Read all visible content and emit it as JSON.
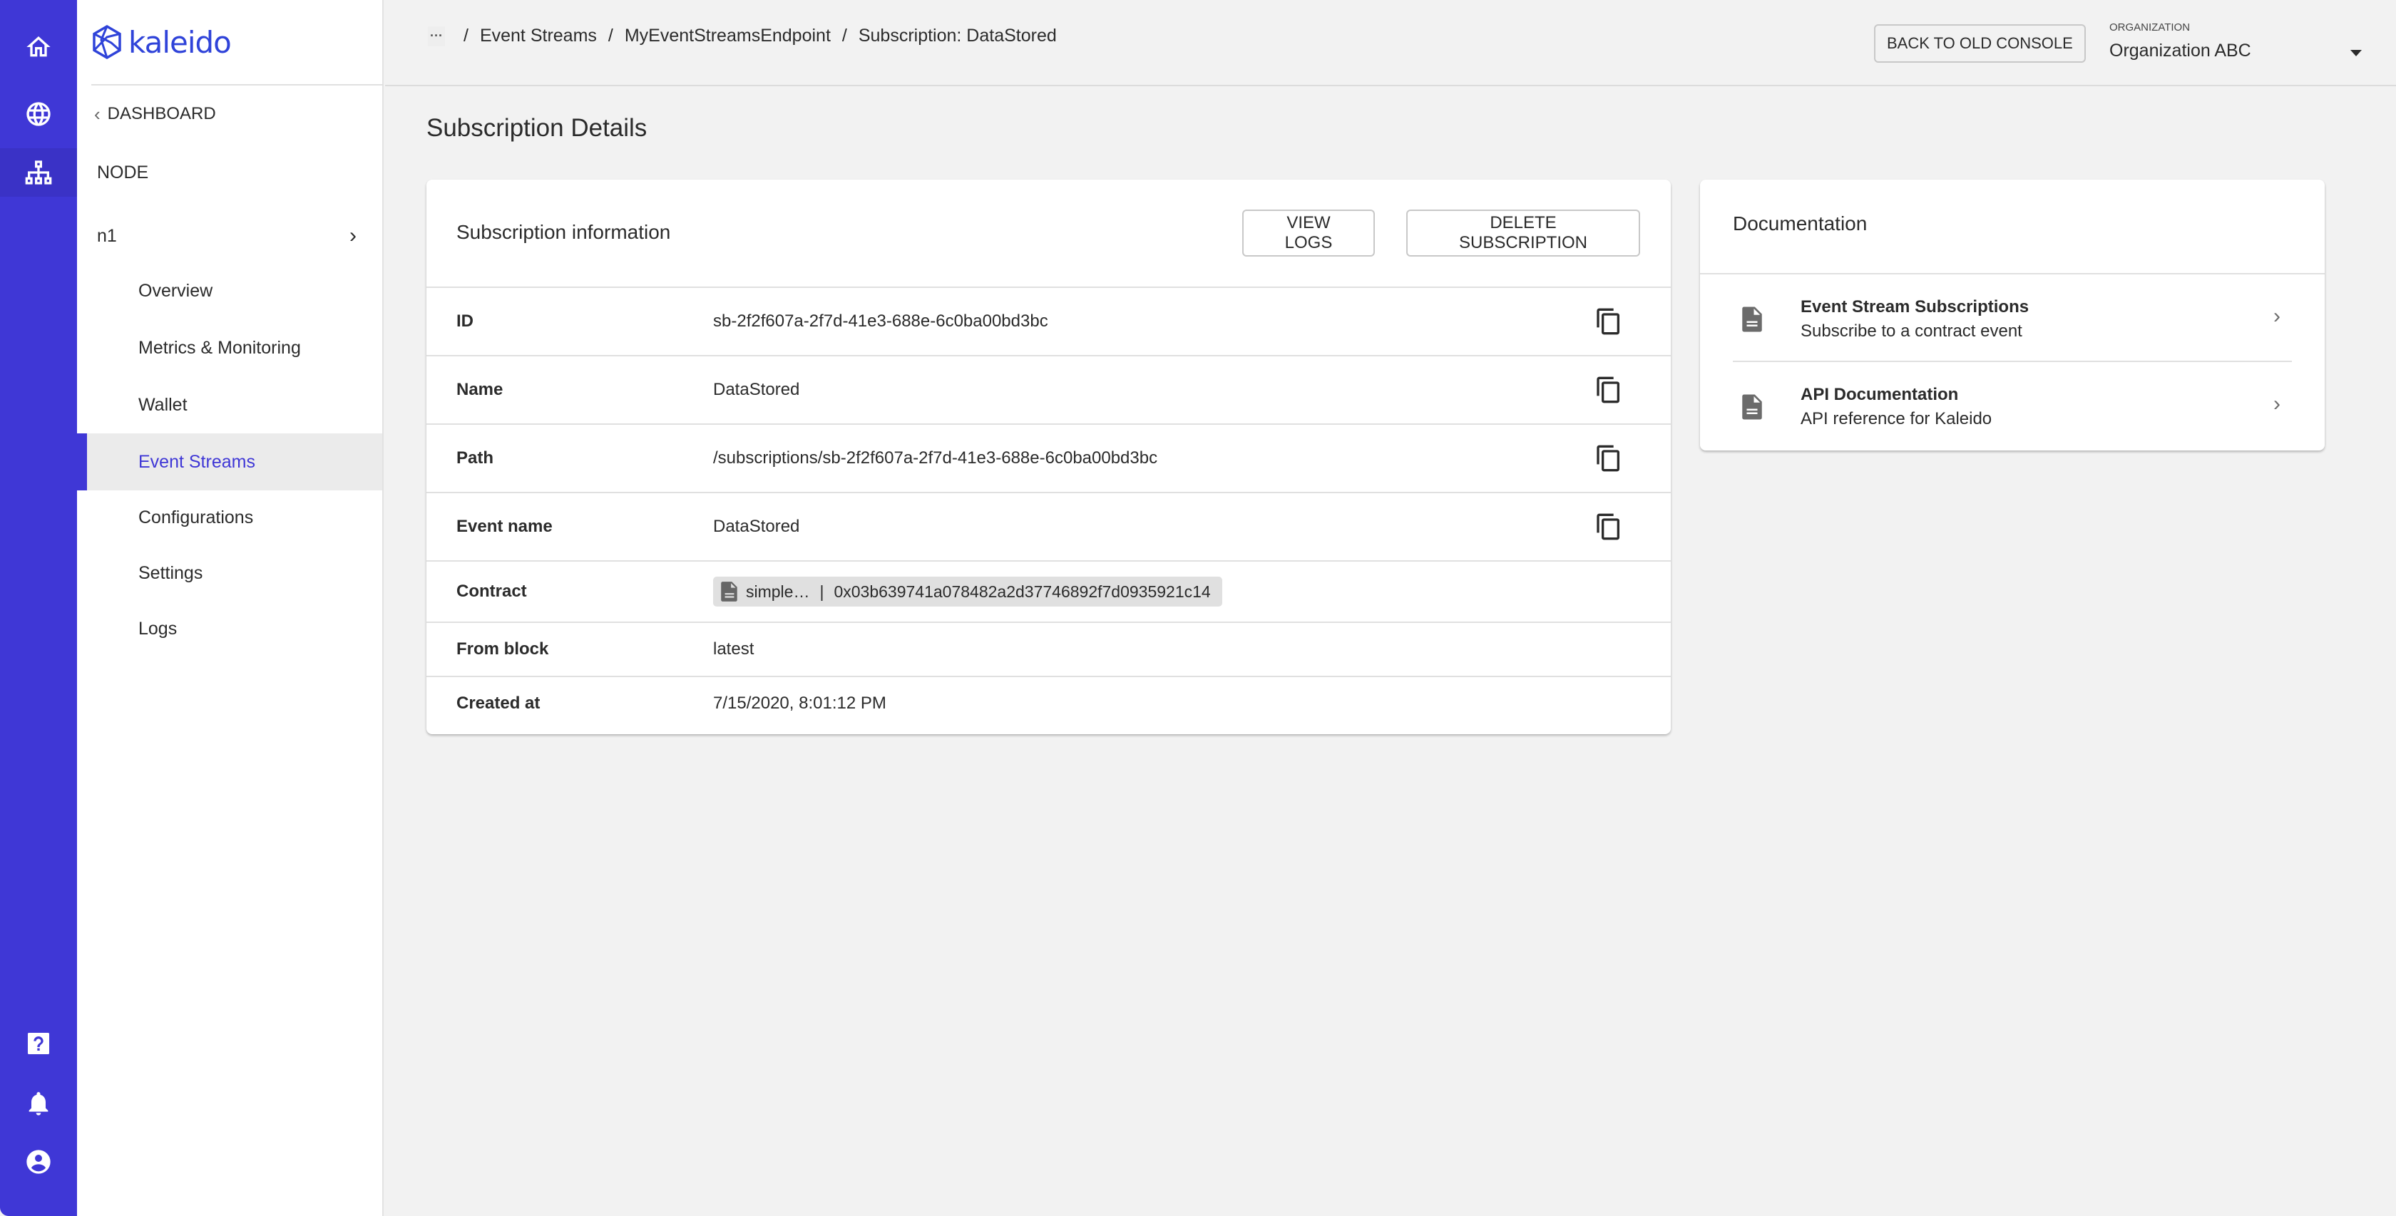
{
  "brand": {
    "name": "kaleido",
    "accent": "#3f37d6",
    "logo_color": "#2f43d9"
  },
  "rail": {
    "top": [
      {
        "icon": "home-icon",
        "active": false
      },
      {
        "icon": "globe-icon",
        "active": false
      },
      {
        "icon": "network-icon",
        "active": true
      }
    ],
    "bottom": [
      {
        "icon": "help-icon"
      },
      {
        "icon": "bell-icon"
      },
      {
        "icon": "account-icon"
      }
    ]
  },
  "sidebar": {
    "back_label": "DASHBOARD",
    "section_title": "NODE",
    "node_name": "n1",
    "items": [
      {
        "label": "Overview",
        "active": false
      },
      {
        "label": "Metrics & Monitoring",
        "active": false
      },
      {
        "label": "Wallet",
        "active": false
      },
      {
        "label": "Event Streams",
        "active": true
      },
      {
        "label": "Configurations",
        "active": false
      },
      {
        "label": "Settings",
        "active": false
      },
      {
        "label": "Logs",
        "active": false
      }
    ]
  },
  "header": {
    "breadcrumb_more": "···",
    "breadcrumbs": [
      "Event Streams",
      "MyEventStreamsEndpoint",
      "Subscription: DataStored"
    ],
    "separator": "/",
    "old_console_label": "BACK TO OLD CONSOLE",
    "org_label": "ORGANIZATION",
    "org_value": "Organization ABC"
  },
  "page": {
    "title": "Subscription Details"
  },
  "info_card": {
    "title": "Subscription information",
    "view_logs_label": "VIEW LOGS",
    "delete_label": "DELETE SUBSCRIPTION",
    "rows": [
      {
        "label": "ID",
        "value": "sb-2f2f607a-2f7d-41e3-688e-6c0ba00bd3bc",
        "copy": true
      },
      {
        "label": "Name",
        "value": "DataStored",
        "copy": true
      },
      {
        "label": "Path",
        "value": "/subscriptions/sb-2f2f607a-2f7d-41e3-688e-6c0ba00bd3bc",
        "copy": true
      },
      {
        "label": "Event name",
        "value": "DataStored",
        "copy": true
      },
      {
        "label": "Contract",
        "chip_name": "simple…",
        "chip_sep": "|",
        "chip_address": "0x03b639741a078482a2d37746892f7d0935921c14"
      },
      {
        "label": "From block",
        "value": "latest"
      },
      {
        "label": "Created at",
        "value": "7/15/2020, 8:01:12 PM"
      }
    ]
  },
  "doc_card": {
    "title": "Documentation",
    "items": [
      {
        "name": "Event Stream Subscriptions",
        "desc": "Subscribe to a contract event"
      },
      {
        "name": "API Documentation",
        "desc": "API reference for Kaleido"
      }
    ]
  }
}
